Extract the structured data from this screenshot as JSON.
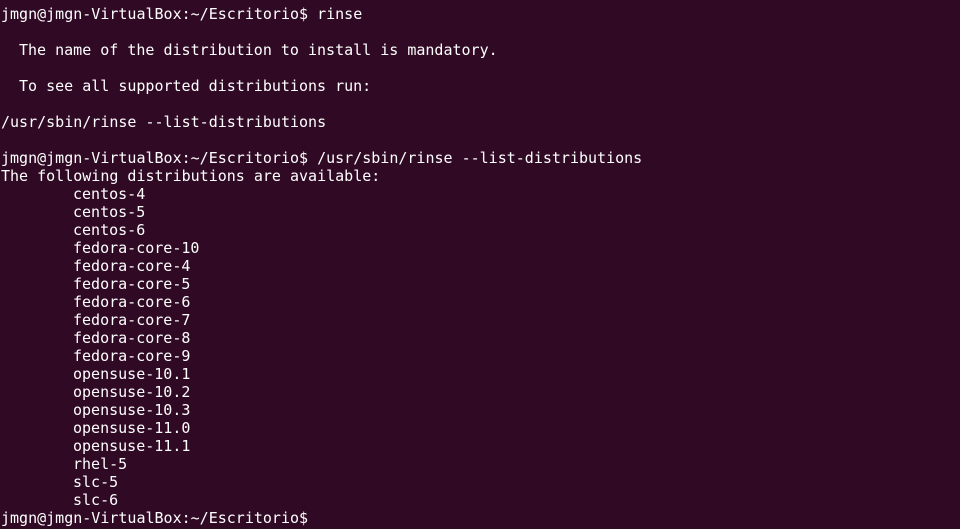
{
  "theme": {
    "background": "#300a24",
    "foreground": "#ffffff"
  },
  "prompt": "jmgn@jmgn-VirtualBox:~/Escritorio$",
  "session": {
    "cmd1": "rinse",
    "error_line1": "The name of the distribution to install is mandatory.",
    "error_line2": "To see all supported distributions run:",
    "suggested_command": "/usr/sbin/rinse --list-distributions",
    "cmd2": "/usr/sbin/rinse --list-distributions",
    "list_header": "The following distributions are available:",
    "distributions": [
      "centos-4",
      "centos-5",
      "centos-6",
      "fedora-core-10",
      "fedora-core-4",
      "fedora-core-5",
      "fedora-core-6",
      "fedora-core-7",
      "fedora-core-8",
      "fedora-core-9",
      "opensuse-10.1",
      "opensuse-10.2",
      "opensuse-10.3",
      "opensuse-11.0",
      "opensuse-11.1",
      "rhel-5",
      "slc-5",
      "slc-6"
    ]
  }
}
